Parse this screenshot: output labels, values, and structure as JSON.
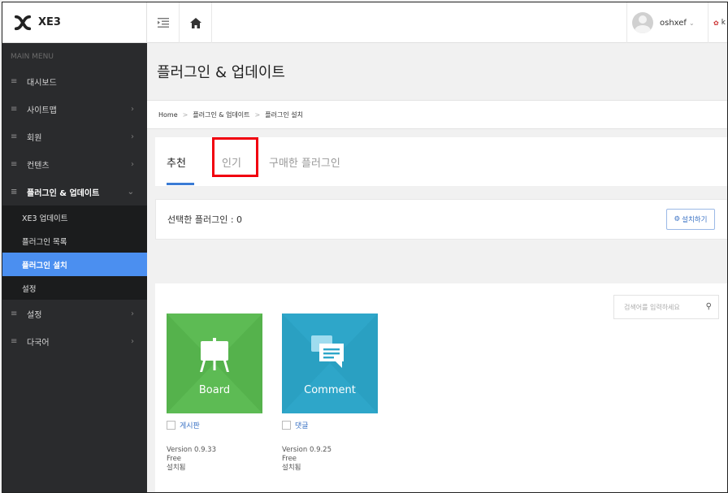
{
  "app": {
    "name": "XE3"
  },
  "sidebar": {
    "caption": "MAIN MENU",
    "items": [
      {
        "label": "대시보드",
        "has_children": false
      },
      {
        "label": "사이트맵",
        "has_children": true
      },
      {
        "label": "회원",
        "has_children": true
      },
      {
        "label": "컨텐츠",
        "has_children": true
      },
      {
        "label": "플러그인 & 업데이트",
        "has_children": true,
        "open": true
      },
      {
        "label": "설정",
        "has_children": true
      },
      {
        "label": "다국어",
        "has_children": true
      }
    ],
    "submenu": [
      {
        "label": "XE3 업데이트",
        "active": false
      },
      {
        "label": "플러그인 목록",
        "active": false
      },
      {
        "label": "플러그인 설치",
        "active": true
      },
      {
        "label": "설정",
        "active": false
      }
    ]
  },
  "topbar": {
    "user_name": "oshxef",
    "language": "k"
  },
  "page": {
    "title": "플러그인 & 업데이트",
    "breadcrumb": [
      "Home",
      "플러그인 & 업데이트",
      "플러그인 설치"
    ],
    "breadcrumb_sep": ">"
  },
  "tabs": [
    {
      "label": "추천",
      "active": true
    },
    {
      "label": "인기",
      "active": false,
      "highlighted": true
    },
    {
      "label": "구매한 플러그인",
      "active": false
    }
  ],
  "selection": {
    "label": "선택한 플러그인 : 0",
    "install_button": "설치하기"
  },
  "search": {
    "placeholder": "검색어를 입력하세요"
  },
  "plugins": [
    {
      "title": "Board",
      "name": "게시판",
      "version": "Version 0.9.33",
      "price": "Free",
      "status": "설치됨",
      "color": "#5dbb54",
      "icon": "easel-icon"
    },
    {
      "title": "Comment",
      "name": "댓글",
      "version": "Version 0.9.25",
      "price": "Free",
      "status": "설치됨",
      "color": "#2ea6c9",
      "icon": "chat-bubble-icon"
    }
  ],
  "colors": {
    "sidebar_bg": "#2a2b2d",
    "active_item": "#4b8ff0",
    "highlight": "#f1000f",
    "accent": "#3a7bd5"
  }
}
